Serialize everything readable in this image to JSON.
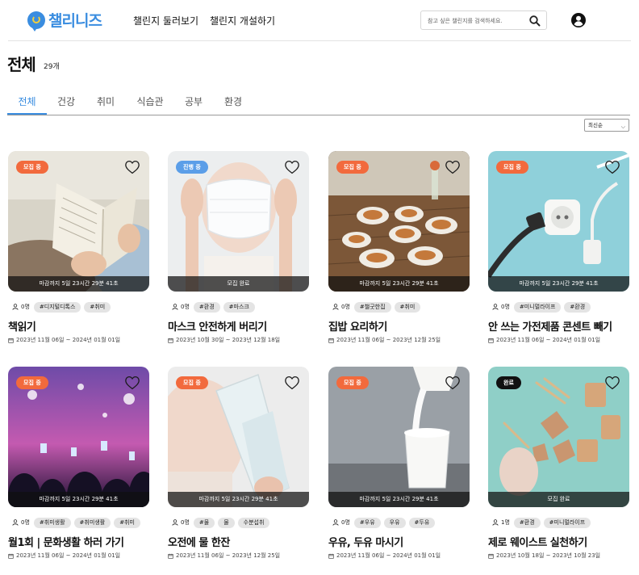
{
  "header": {
    "logo_text": "챌리니즈",
    "nav": {
      "browse": "챌린지 둘러보기",
      "create": "챌린지 개설하기"
    },
    "search_placeholder": "참고 싶은 챌린지를 검색하세요.",
    "icons": {
      "search": "search-icon",
      "user": "user-circle-icon"
    }
  },
  "page": {
    "title": "전체",
    "count": "29개"
  },
  "tabs": [
    "전체",
    "건강",
    "취미",
    "식습관",
    "공부",
    "환경"
  ],
  "sort": {
    "selected": "최신순"
  },
  "colors": {
    "accent": "#3a8de0",
    "recruiting": "#f26a3d",
    "ongoing": "#5b9ee8",
    "done": "#111111"
  },
  "cards": [
    {
      "status": "모집 중",
      "status_kind": "recruiting",
      "deadline": "마감까지 5일 23시간 29분 41초",
      "people": "0명",
      "tags": [
        "#디지털디톡스",
        "#취미"
      ],
      "title": "책읽기",
      "period": "2023년 11월 06일 ~ 2024년 01월 01일"
    },
    {
      "status": "진행 중",
      "status_kind": "ongoing",
      "deadline": "모집 완료",
      "people": "0명",
      "tags": [
        "#환경",
        "#마스크"
      ],
      "title": "마스크 안전하게 버리기",
      "period": "2023년 10월 30일 ~ 2023년 12월 18일"
    },
    {
      "status": "모집 중",
      "status_kind": "recruiting",
      "deadline": "마감까지 5일 23시간 29분 41초",
      "people": "0명",
      "tags": [
        "#챌굿한집",
        "#취미"
      ],
      "title": "집밥 요리하기",
      "period": "2023년 11월 06일 ~ 2023년 12월 25일"
    },
    {
      "status": "모집 중",
      "status_kind": "recruiting",
      "deadline": "마감까지 5일 23시간 29분 41초",
      "people": "0명",
      "tags": [
        "#미니멀라이프",
        "#환경"
      ],
      "title": "안 쓰는 가전제품 콘센트 빼기",
      "period": "2023년 11월 06일 ~ 2024년 01월 01일"
    },
    {
      "status": "모집 중",
      "status_kind": "recruiting",
      "deadline": "마감까지 5일 23시간 29분 41초",
      "people": "0명",
      "tags": [
        "#취미생활",
        "#취미생활",
        "#취미"
      ],
      "title": "월1회 | 문화생활 하러 가기",
      "period": "2023년 11월 06일 ~ 2024년 01월 01일"
    },
    {
      "status": "모집 중",
      "status_kind": "recruiting",
      "deadline": "마감까지 5일 23시간 29분 41초",
      "people": "0명",
      "tags": [
        "#물",
        "물",
        "수분섭취"
      ],
      "title": "오전에 물 한잔",
      "period": "2023년 11월 06일 ~ 2023년 12월 25일"
    },
    {
      "status": "모집 중",
      "status_kind": "recruiting",
      "deadline": "마감까지 5일 23시간 29분 41초",
      "people": "0명",
      "tags": [
        "#우유",
        "우유",
        "#두유"
      ],
      "title": "우유, 두유 마시기",
      "period": "2023년 11월 06일 ~ 2024년 01월 01일"
    },
    {
      "status": "완료",
      "status_kind": "done",
      "deadline": "모집 완료",
      "people": "1명",
      "tags": [
        "#환경",
        "#미니멀라이프"
      ],
      "title": "제로 웨이스트 실천하기",
      "period": "2023년 10월 18일 ~ 2023년 10월 23일"
    }
  ]
}
